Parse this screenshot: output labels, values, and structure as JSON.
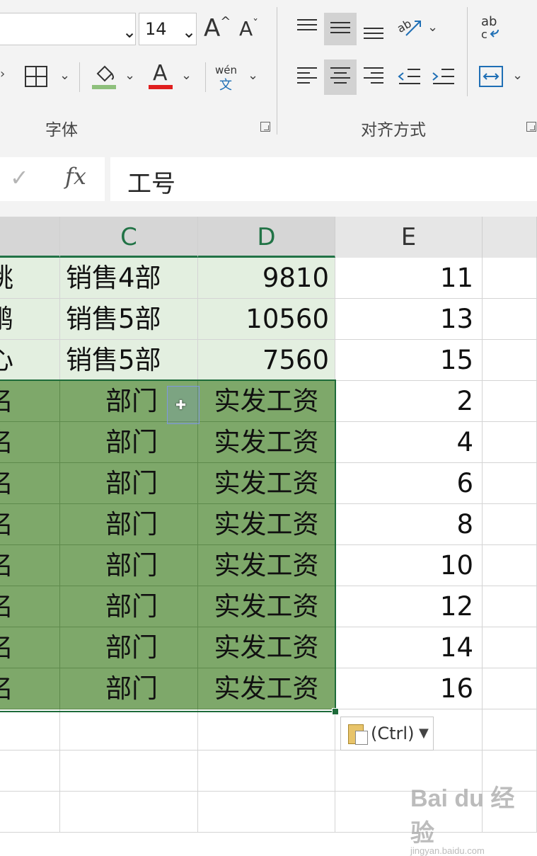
{
  "ribbon": {
    "font_size_value": "14",
    "grow_font_label": "A",
    "shrink_font_label": "A",
    "wen_label": "wén",
    "wen_char": "文",
    "font_color_letter": "A",
    "font_group_label": "字体",
    "align_group_label": "对齐方式",
    "wrap_label": "ab",
    "colors": {
      "fill_bar": "#8ec07c",
      "font_bar": "#e01e1e",
      "accent": "#217346"
    }
  },
  "formula_bar": {
    "check_icon": "check-icon",
    "fx_label": "fx",
    "content": "工号"
  },
  "columns": [
    "C",
    "D",
    "E"
  ],
  "rows_light": [
    {
      "b": "姚",
      "c": "销售4部",
      "d": "9810",
      "e": "11"
    },
    {
      "b": "鹏",
      "c": "销售5部",
      "d": "10560",
      "e": "13"
    },
    {
      "b": "心",
      "c": "销售5部",
      "d": "7560",
      "e": "15"
    }
  ],
  "rows_dark": [
    {
      "b": "名",
      "c": "部门",
      "d": "实发工资",
      "e": "2"
    },
    {
      "b": "名",
      "c": "部门",
      "d": "实发工资",
      "e": "4"
    },
    {
      "b": "名",
      "c": "部门",
      "d": "实发工资",
      "e": "6"
    },
    {
      "b": "名",
      "c": "部门",
      "d": "实发工资",
      "e": "8"
    },
    {
      "b": "名",
      "c": "部门",
      "d": "实发工资",
      "e": "10"
    },
    {
      "b": "名",
      "c": "部门",
      "d": "实发工资",
      "e": "12"
    },
    {
      "b": "名",
      "c": "部门",
      "d": "实发工资",
      "e": "14"
    },
    {
      "b": "名",
      "c": "部门",
      "d": "实发工资",
      "e": "16"
    }
  ],
  "paste_options": {
    "label": "(Ctrl)",
    "icon": "clipboard-icon"
  },
  "watermark": {
    "brand": "Bai du 经验",
    "url": "jingyan.baidu.com"
  }
}
